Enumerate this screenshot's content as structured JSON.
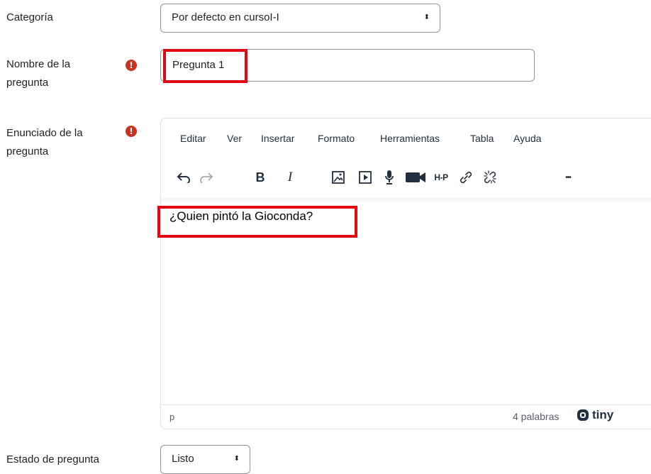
{
  "categoria": {
    "label": "Categoría",
    "value": "Por defecto en cursoI-I"
  },
  "nombre": {
    "label_line1": "Nombre de la",
    "label_line2": "pregunta",
    "value": "Pregunta 1"
  },
  "enunciado": {
    "label_line1": "Enunciado de la",
    "label_line2": "pregunta",
    "menu": [
      "Editar",
      "Ver",
      "Insertar",
      "Formato",
      "Herramientas",
      "Tabla",
      "Ayuda"
    ],
    "toolbar_icons": [
      "undo-icon",
      "redo-icon",
      "bold-icon",
      "italic-icon",
      "image-icon",
      "media-icon",
      "microphone-icon",
      "video-camera-icon",
      "h5p-icon",
      "link-icon",
      "unlink-icon",
      "more-icon"
    ],
    "toolbar_text": {
      "bold": "B",
      "italic": "I",
      "h5p": "H-P",
      "more": "•••"
    },
    "content": "¿Quien pintó la Gioconda?",
    "status_path": "p",
    "word_count": "4 palabras",
    "brand": "tiny"
  },
  "estado": {
    "label": "Estado de pregunta",
    "value": "Listo"
  },
  "colors": {
    "required": "#ca3120",
    "highlight": "#e30613",
    "border": "#8f959e"
  }
}
